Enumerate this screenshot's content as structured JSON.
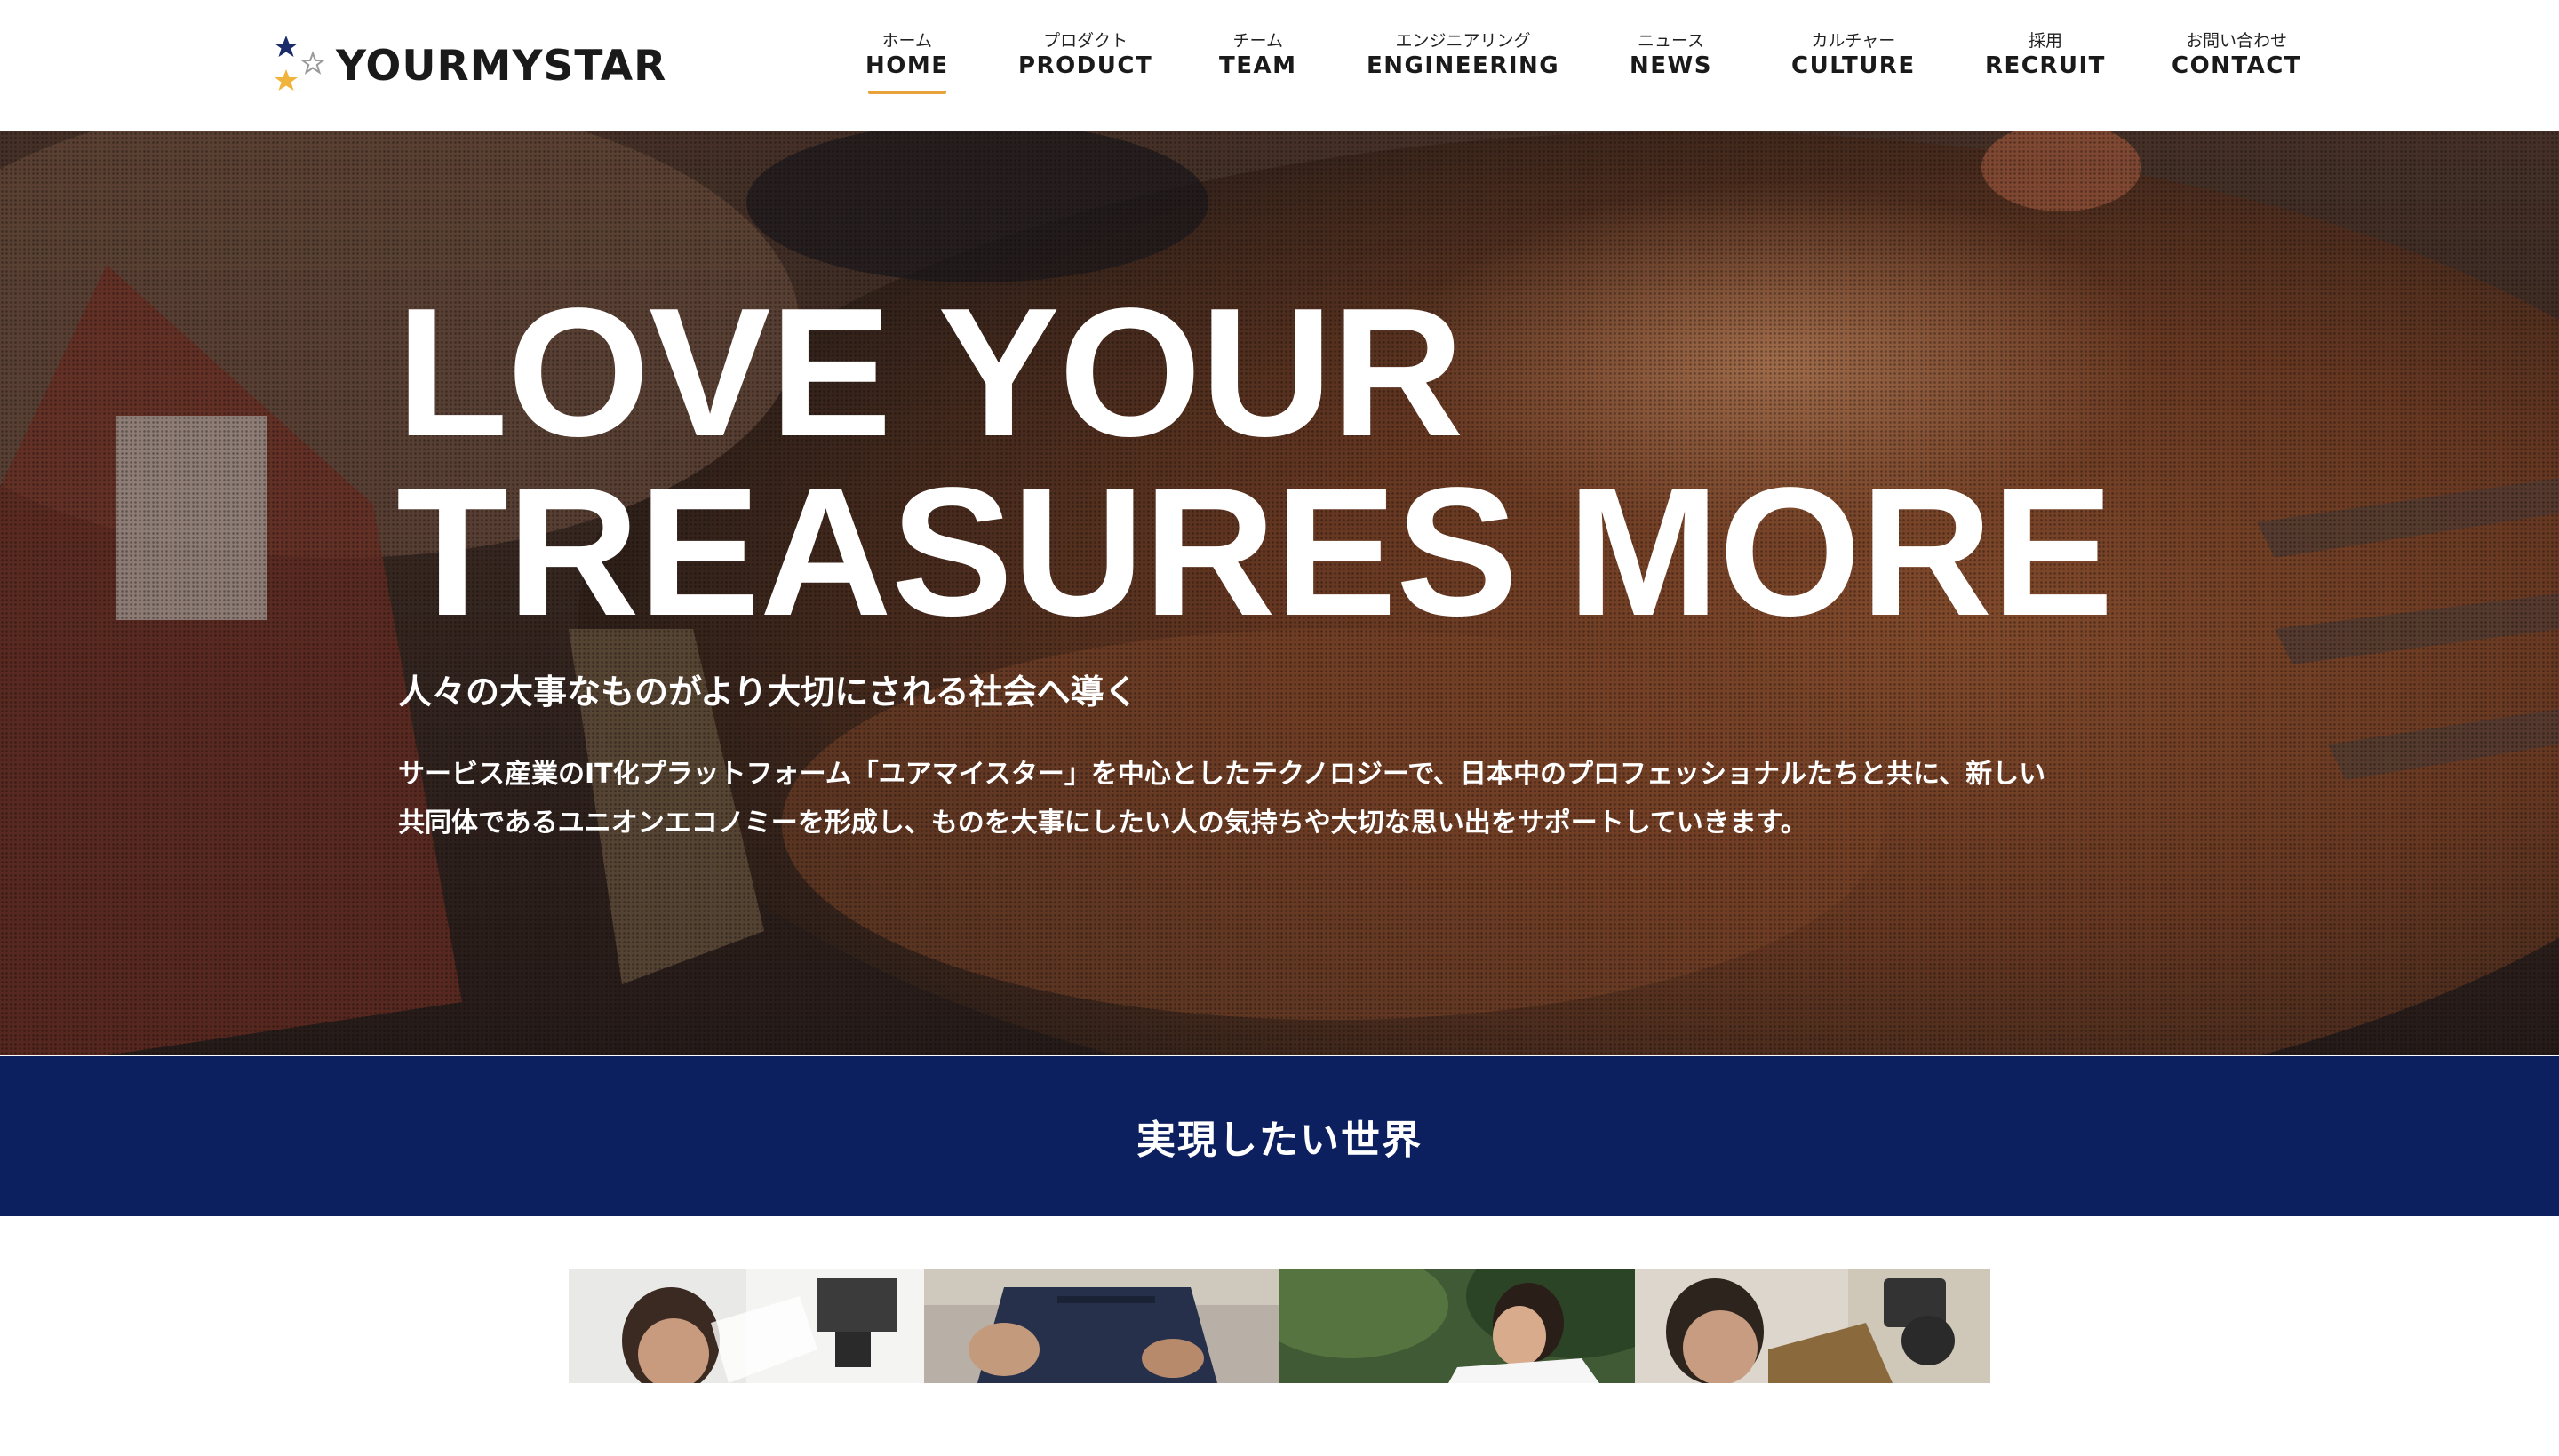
{
  "brand": {
    "name": "YOURMYSTAR",
    "colors": {
      "navy": "#0c1f5e",
      "accent": "#e8a23a",
      "star_blue": "#1a2c6b",
      "star_gold": "#f0b43c"
    }
  },
  "nav": {
    "items": [
      {
        "jp": "ホーム",
        "en": "HOME",
        "active": true
      },
      {
        "jp": "プロダクト",
        "en": "PRODUCT"
      },
      {
        "jp": "チーム",
        "en": "TEAM"
      },
      {
        "jp": "エンジニアリング",
        "en": "ENGINEERING"
      },
      {
        "jp": "ニュース",
        "en": "NEWS"
      },
      {
        "jp": "カルチャー",
        "en": "CULTURE"
      },
      {
        "jp": "採用",
        "en": "RECRUIT"
      },
      {
        "jp": "お問い合わせ",
        "en": "CONTACT"
      }
    ]
  },
  "hero": {
    "title_line1": "LOVE YOUR",
    "title_line2": "TREASURES MORE",
    "subtitle": "人々の大事なものがより大切にされる社会へ導く",
    "desc_line1": "サービス産業のIT化プラットフォーム「ユアマイスター」を中心としたテクノロジーで、日本中のプロフェッショナルたちと共に、新しい",
    "desc_line2": "共同体であるユニオンエコノミーを形成し、ものを大事にしたい人の気持ちや大切な思い出をサポートしていきます。"
  },
  "section": {
    "title": "実現したい世界"
  },
  "photos": [
    "worker-photo-1",
    "worker-photo-2",
    "worker-photo-3",
    "worker-photo-4"
  ]
}
